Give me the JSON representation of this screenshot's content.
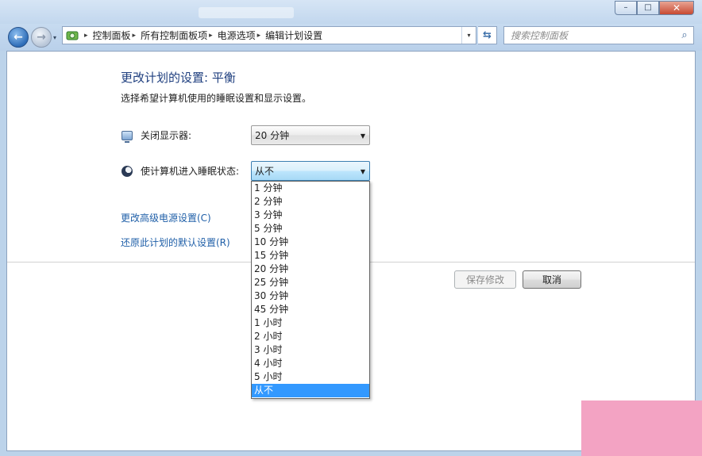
{
  "window": {
    "minimize_glyph": "–",
    "maximize_glyph": "□",
    "close_glyph": "✕"
  },
  "nav": {
    "back_glyph": "←",
    "forward_glyph": "→",
    "dropdown_glyph": "▾",
    "breadcrumbs": [
      "控制面板",
      "所有控制面板项",
      "电源选项",
      "编辑计划设置"
    ],
    "separator_glyph": "▸",
    "address_dropdown_glyph": "▾",
    "refresh_glyph": "⇆",
    "search_placeholder": "搜索控制面板",
    "search_glyph": "⌕"
  },
  "main": {
    "heading": "更改计划的设置: 平衡",
    "subheading": "选择希望计算机使用的睡眠设置和显示设置。",
    "display_off": {
      "label": "关闭显示器:",
      "value": "20 分钟",
      "icon": "monitor-icon"
    },
    "sleep": {
      "label": "使计算机进入睡眠状态:",
      "value": "从不",
      "icon": "moon-icon"
    },
    "select_arrow_glyph": "▼",
    "links": {
      "advanced": "更改高级电源设置(C)",
      "restore": "还原此计划的默认设置(R)"
    },
    "buttons": {
      "save": "保存修改",
      "cancel": "取消"
    },
    "sleep_options": [
      "1 分钟",
      "2 分钟",
      "3 分钟",
      "5 分钟",
      "10 分钟",
      "15 分钟",
      "20 分钟",
      "25 分钟",
      "30 分钟",
      "45 分钟",
      "1 小时",
      "2 小时",
      "3 小时",
      "4 小时",
      "5 小时",
      "从不"
    ],
    "sleep_selected_index": 15
  },
  "colors": {
    "heading": "#1f3f7f",
    "link": "#1f5fa8",
    "selection": "#3399ff",
    "corner_block": "#f3a3c3"
  }
}
